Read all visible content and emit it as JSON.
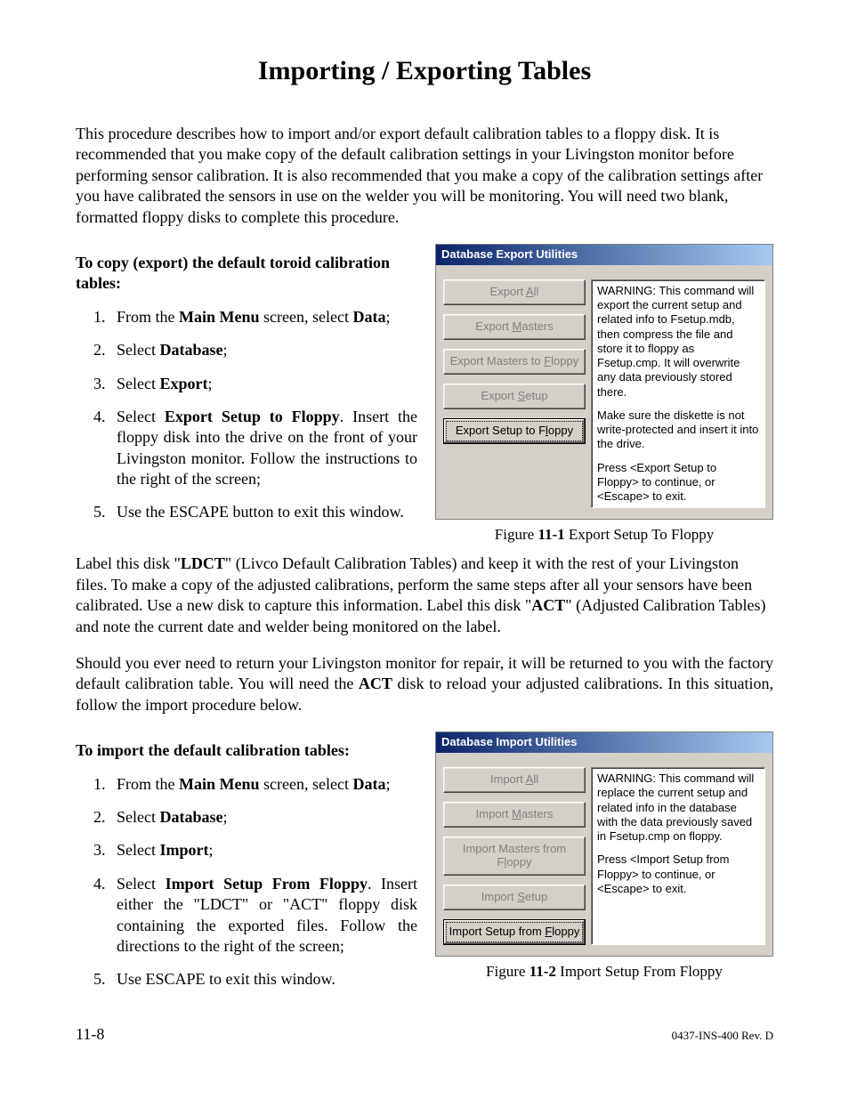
{
  "title": "Importing / Exporting Tables",
  "intro": "This procedure describes how to import and/or export default calibration tables to a floppy disk. It is recommended that you make copy of the default calibration settings in your Livingston monitor before performing sensor calibration. It is also recommended that you make a copy of the calibration settings after you have calibrated the sensors in use on the welder you will be monitoring. You will need two blank, formatted floppy disks to complete this procedure.",
  "export_heading": "To copy (export) the default toroid calibration tables:",
  "export_steps": [
    {
      "pre": "From the ",
      "b1": "Main Menu",
      "mid": " screen, select ",
      "b2": "Data",
      "post": ";"
    },
    {
      "pre": "Select ",
      "b1": "Database",
      "post": ";"
    },
    {
      "pre": "Select ",
      "b1": "Export",
      "post": ";"
    },
    {
      "pre": "Select ",
      "b1": "Export Setup to Floppy",
      "post": ". Insert the floppy disk into the drive on the front of your Livingston monitor. Follow the instructions to the right of the screen;"
    },
    {
      "pre": "Use the ESCAPE button to exit this window."
    }
  ],
  "export_dialog": {
    "title": "Database Export Utilities",
    "buttons": [
      {
        "pre": "Export ",
        "u": "A",
        "post": "ll"
      },
      {
        "pre": "Export ",
        "u": "M",
        "post": "asters"
      },
      {
        "pre": "Export Masters to ",
        "u": "F",
        "post": "loppy"
      },
      {
        "pre": "Export ",
        "u": "S",
        "post": "etup"
      },
      {
        "pre": "Export Setup to F",
        "u": "l",
        "post": "oppy",
        "selected": true
      }
    ],
    "panel": [
      "WARNING: This command will export the current setup and related info to Fsetup.mdb, then compress the file and store it to floppy as Fsetup.cmp.  It will overwrite any data previously stored there.",
      "Make sure the diskette is not write-protected and insert it into the drive.",
      "Press <Export Setup to Floppy> to continue, or <Escape> to exit."
    ]
  },
  "fig1_num": "11-1",
  "fig1_text": " Export Setup To Floppy",
  "mid_p1": {
    "seg1": "Label this disk \"",
    "b1": "LDCT",
    "seg2": "\" (Livco Default Calibration Tables) and keep it with the rest of your Livingston files. To make a copy of the adjusted calibrations, perform the same steps after all your sensors have been calibrated. Use a new disk to capture this information. Label this disk \"",
    "b2": "ACT",
    "seg3": "\" (Adjusted Calibration Tables) and note the current date and welder being monitored on the label."
  },
  "mid_p2": {
    "seg1": "Should you ever need to return your Livingston monitor for repair, it will be returned to you with the factory default calibration table. You will need the ",
    "b1": "ACT",
    "seg2": " disk to reload your adjusted calibrations. In this situation, follow the import procedure below."
  },
  "import_heading": "To import the default calibration tables:",
  "import_steps": [
    {
      "pre": "From the ",
      "b1": "Main Menu",
      "mid": " screen, select ",
      "b2": "Data",
      "post": ";"
    },
    {
      "pre": "Select ",
      "b1": "Database",
      "post": ";"
    },
    {
      "pre": "Select ",
      "b1": "Import",
      "post": ";"
    },
    {
      "pre": "Select ",
      "b1": "Import Setup From Floppy",
      "post": ". Insert either the \"LDCT\" or \"ACT\" floppy disk containing the exported files. Follow the directions to the right of the screen;"
    },
    {
      "pre": "Use ESCAPE to exit this window."
    }
  ],
  "import_dialog": {
    "title": "Database Import Utilities",
    "buttons": [
      {
        "pre": "Import ",
        "u": "A",
        "post": "ll"
      },
      {
        "pre": "Import ",
        "u": "M",
        "post": "asters"
      },
      {
        "pre": "Import Masters from F",
        "u": "l",
        "post": "oppy"
      },
      {
        "pre": "Import ",
        "u": "S",
        "post": "etup"
      },
      {
        "pre": "Import Setup from ",
        "u": "F",
        "post": "loppy",
        "selected": true
      }
    ],
    "panel": [
      "WARNING: This command will replace the current setup and related info in the database with the data previously saved in Fsetup.cmp on floppy.",
      "Press <Import Setup from Floppy> to continue, or <Escape> to exit."
    ]
  },
  "fig2_num": "11-2",
  "fig2_text": " Import Setup From Floppy",
  "footer_page": "11-8",
  "footer_doc": "0437-INS-400 Rev. D"
}
